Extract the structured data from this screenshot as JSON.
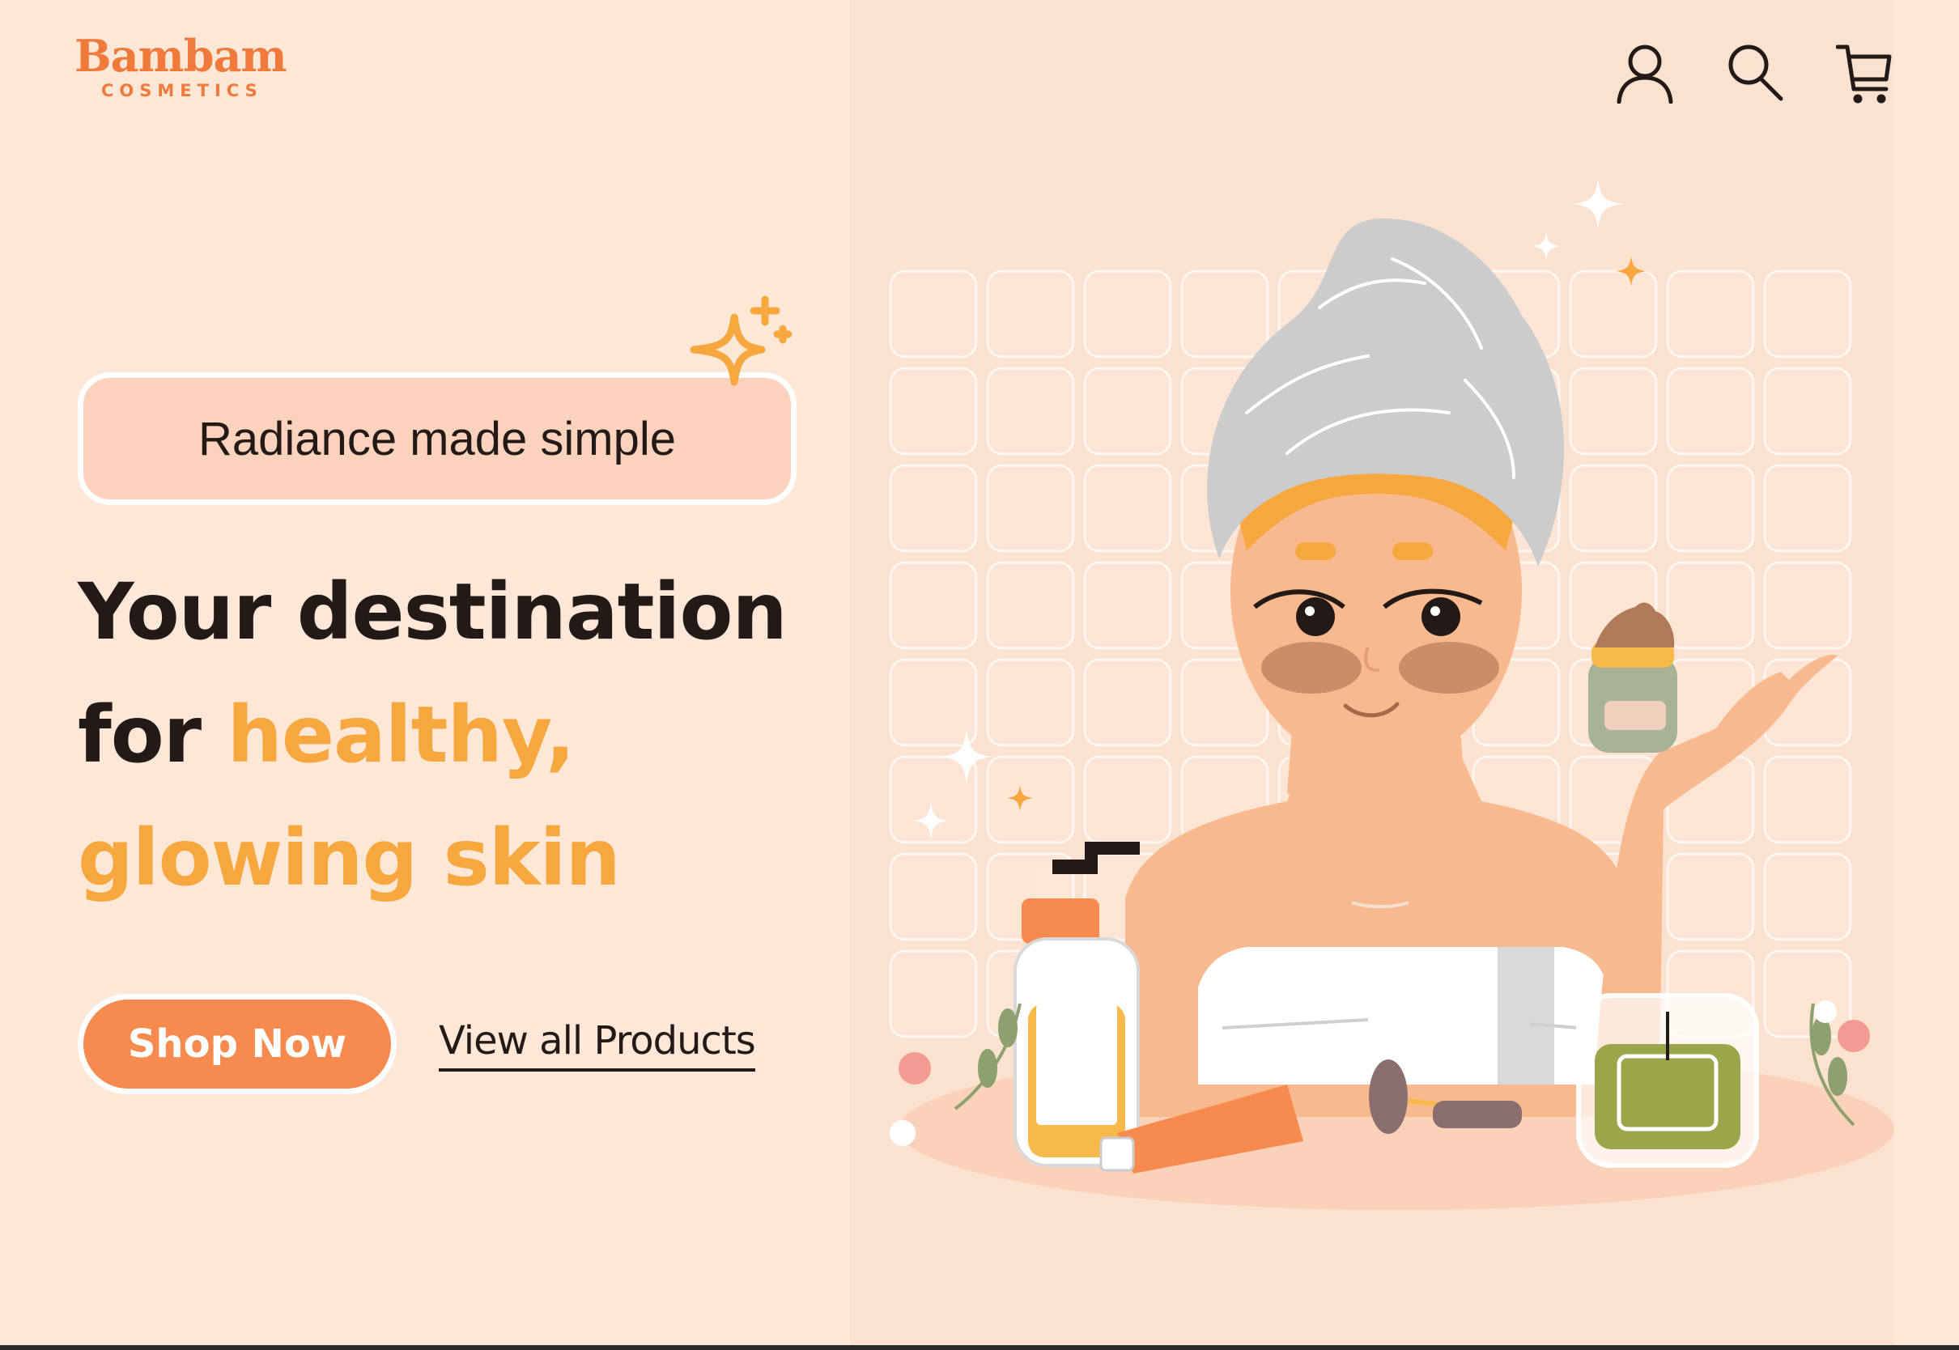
{
  "brand": {
    "name": "Bambam",
    "subtitle": "COSMETICS",
    "color": "#f07a3c"
  },
  "header": {
    "icons": [
      "user-icon",
      "search-icon",
      "cart-icon"
    ]
  },
  "hero": {
    "tagline": "Radiance made simple",
    "headline_part1": "Your destination",
    "headline_part2": "for ",
    "headline_accent1": "healthy,",
    "headline_accent2": "glowing skin",
    "primary_cta": "Shop Now",
    "secondary_cta": "View all Products"
  },
  "colors": {
    "background": "#fde7d7",
    "accent": "#f6a73e",
    "button": "#f78a4e",
    "text": "#231a17"
  }
}
